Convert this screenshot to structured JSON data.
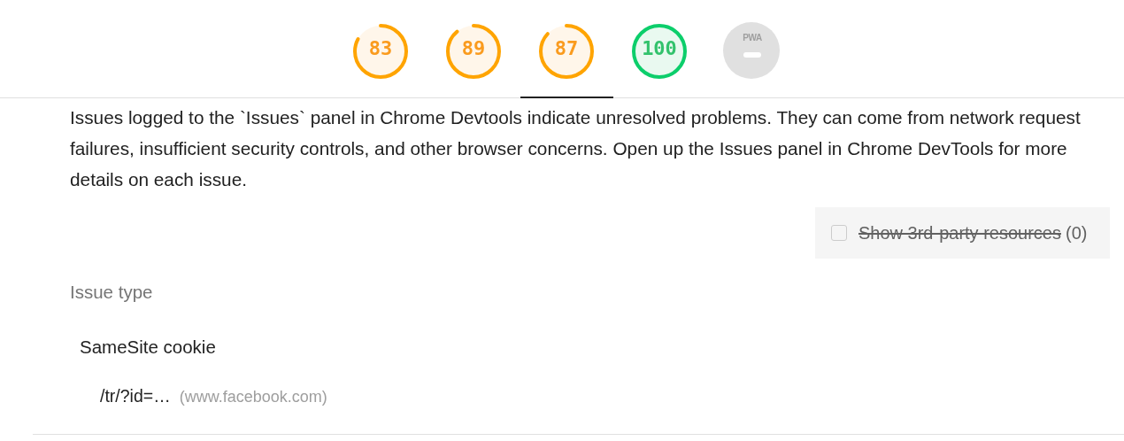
{
  "gauges": [
    {
      "score": "83",
      "kind": "average",
      "selected": false
    },
    {
      "score": "89",
      "kind": "average",
      "selected": false
    },
    {
      "score": "87",
      "kind": "average",
      "selected": true
    },
    {
      "score": "100",
      "kind": "pass",
      "selected": false
    },
    {
      "score": "PWA",
      "kind": "na",
      "selected": false
    }
  ],
  "description": "Issues logged to the `Issues` panel in Chrome Devtools indicate unresolved problems. They can come from network request failures, insufficient security controls, and other browser concerns. Open up the Issues panel in Chrome DevTools for more details on each issue.",
  "third_party_filter": {
    "label": "Show 3rd-party resources",
    "count": "(0)",
    "checked": false,
    "disabled": true
  },
  "table": {
    "column": "Issue type",
    "groups": [
      {
        "name": "SameSite cookie",
        "items": [
          {
            "url": "/tr/?id=…",
            "host": "(www.facebook.com)"
          }
        ]
      }
    ]
  }
}
